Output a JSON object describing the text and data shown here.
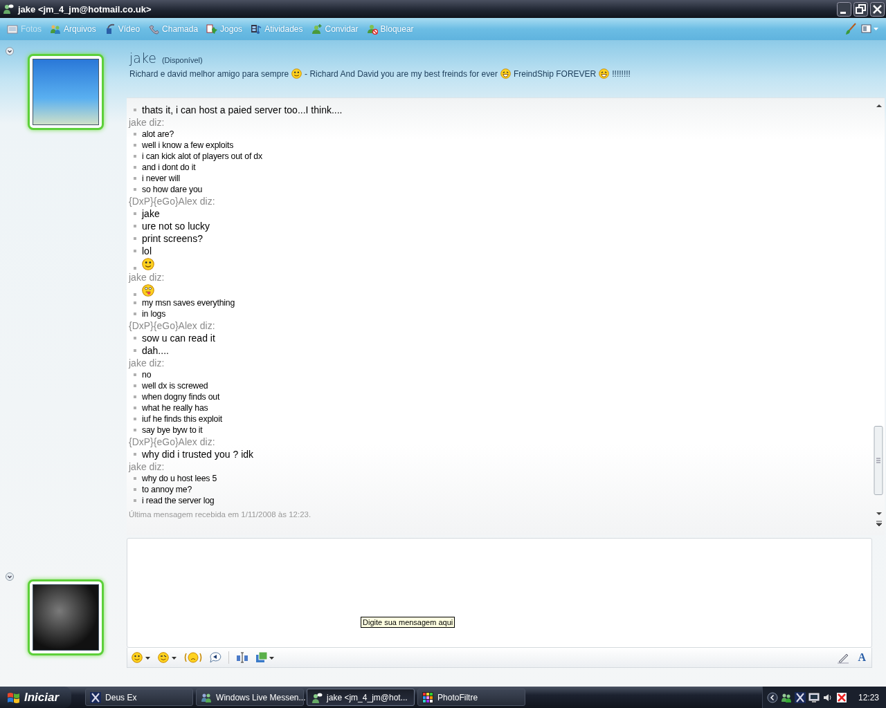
{
  "window": {
    "title": "jake <jm_4_jm@hotmail.co.uk>"
  },
  "toolbar": {
    "items": [
      {
        "kind": "photos",
        "label": "Fotos",
        "disabled": true
      },
      {
        "kind": "files",
        "label": "Arquivos",
        "disabled": false
      },
      {
        "kind": "video",
        "label": "Vídeo",
        "disabled": false
      },
      {
        "kind": "call",
        "label": "Chamada",
        "disabled": false
      },
      {
        "kind": "games",
        "label": "Jogos",
        "disabled": false
      },
      {
        "kind": "activities",
        "label": "Atividades",
        "disabled": false
      },
      {
        "kind": "invite",
        "label": "Convidar",
        "disabled": false
      },
      {
        "kind": "block",
        "label": "Bloquear",
        "disabled": false
      }
    ]
  },
  "contact": {
    "name": "jake",
    "status": "(Disponível)",
    "message": [
      {
        "kind": "text",
        "text": "Richard e david melhor amigo para sempre"
      },
      {
        "kind": "smile"
      },
      {
        "kind": "text",
        "text": "- Richard And David you are my best freinds for ever"
      },
      {
        "kind": "grin"
      },
      {
        "kind": "text",
        "text": "FreindShip FOREVER"
      },
      {
        "kind": "grin"
      },
      {
        "kind": "text",
        "text": "!!!!!!!!"
      }
    ]
  },
  "chat": {
    "blocks": [
      {
        "kind": "self",
        "lines": [
          {
            "kind": "text",
            "text": "thats it, i can host a paied server too...I think...."
          }
        ]
      },
      {
        "kind": "contact",
        "sender": "jake diz:",
        "lines": [
          {
            "kind": "text",
            "text": "alot are?"
          },
          {
            "kind": "text",
            "text": "well i know a few exploits"
          },
          {
            "kind": "text",
            "text": "i can kick alot of players out of dx"
          },
          {
            "kind": "text",
            "text": "and i dont do it"
          },
          {
            "kind": "text",
            "text": "i never will"
          },
          {
            "kind": "text",
            "text": "so how dare you"
          }
        ]
      },
      {
        "kind": "self",
        "sender": "{DxP}{eGo}Alex diz:",
        "lines": [
          {
            "kind": "text",
            "text": "jake"
          },
          {
            "kind": "text",
            "text": "ure not so lucky"
          },
          {
            "kind": "text",
            "text": "print screens?"
          },
          {
            "kind": "text",
            "text": "lol"
          },
          {
            "kind": "smile"
          }
        ]
      },
      {
        "kind": "contact",
        "sender": "jake diz:",
        "lines": [
          {
            "kind": "tongue"
          },
          {
            "kind": "text",
            "text": "my msn saves everything"
          },
          {
            "kind": "text",
            "text": "in logs"
          }
        ]
      },
      {
        "kind": "self",
        "sender": "{DxP}{eGo}Alex diz:",
        "lines": [
          {
            "kind": "text",
            "text": "sow u can read it"
          },
          {
            "kind": "text",
            "text": "dah...."
          }
        ]
      },
      {
        "kind": "contact",
        "sender": "jake diz:",
        "lines": [
          {
            "kind": "text",
            "text": "no"
          },
          {
            "kind": "text",
            "text": "well dx is screwed"
          },
          {
            "kind": "text",
            "text": "when dogny finds out"
          },
          {
            "kind": "text",
            "text": "what he really has"
          },
          {
            "kind": "text",
            "text": "iuf he finds this exploit"
          },
          {
            "kind": "text",
            "text": "say bye byw to it"
          }
        ]
      },
      {
        "kind": "self",
        "sender": "{DxP}{eGo}Alex diz:",
        "lines": [
          {
            "kind": "text",
            "text": "why did i trusted you ? idk"
          }
        ]
      },
      {
        "kind": "contact",
        "sender": "jake diz:",
        "lines": [
          {
            "kind": "text",
            "text": "why do u host lees 5"
          },
          {
            "kind": "text",
            "text": "to annoy me?"
          },
          {
            "kind": "text",
            "text": "i read the server log"
          }
        ]
      }
    ],
    "last_message": "Última mensagem recebida em 1/11/2008 às 12:23."
  },
  "compose": {
    "tooltip": "Digite sua mensagem aqui",
    "font_button": "A"
  },
  "taskbar": {
    "start": "Iniciar",
    "tasks": [
      {
        "kind": "game",
        "label": "Deus Ex",
        "selected": false
      },
      {
        "kind": "messenger",
        "label": "Windows Live Messen...",
        "selected": false
      },
      {
        "kind": "chat",
        "label": "jake <jm_4_jm@hot...",
        "selected": true
      },
      {
        "kind": "editor",
        "label": "PhotoFiltre",
        "selected": false
      }
    ],
    "clock": "12:23"
  }
}
